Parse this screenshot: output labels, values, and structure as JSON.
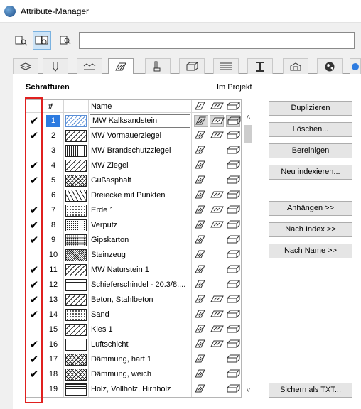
{
  "window": {
    "title": "Attribute-Manager"
  },
  "toolbar": {
    "buttons": [
      {
        "icon": "file-left-view-icon"
      },
      {
        "icon": "split-view-icon"
      },
      {
        "icon": "file-right-view-icon"
      }
    ],
    "search_value": ""
  },
  "tabs": [
    {
      "icon": "layers-icon"
    },
    {
      "icon": "pen-icon"
    },
    {
      "icon": "line-types-icon"
    },
    {
      "icon": "fills-icon",
      "active": true
    },
    {
      "icon": "composites-icon"
    },
    {
      "icon": "profiles-icon"
    },
    {
      "icon": "surfaces-icon"
    },
    {
      "icon": "building-materials-icon"
    },
    {
      "icon": "zone-category-icon"
    },
    {
      "icon": "globe-icon"
    },
    {
      "icon": "more-icon"
    }
  ],
  "section": {
    "title": "Schraffuren",
    "in_project_label": "Im Projekt"
  },
  "grid": {
    "header_num": "#",
    "header_name": "Name",
    "rows": [
      {
        "checked": true,
        "num": "1",
        "name": "MW Kalksandstein",
        "pattern": "diag-blue",
        "selected": true
      },
      {
        "checked": true,
        "num": "2",
        "name": "MW Vormauerziegel",
        "pattern": "diag"
      },
      {
        "checked": false,
        "num": "3",
        "name": "MW Brandschutzziegel",
        "pattern": "hatch-dense"
      },
      {
        "checked": true,
        "num": "4",
        "name": "MW Ziegel",
        "pattern": "diag"
      },
      {
        "checked": true,
        "num": "5",
        "name": "Gußasphalt",
        "pattern": "cross"
      },
      {
        "checked": false,
        "num": "6",
        "name": "Dreiecke mit Punkten",
        "pattern": "triangles"
      },
      {
        "checked": true,
        "num": "7",
        "name": "Erde 1",
        "pattern": "dots"
      },
      {
        "checked": true,
        "num": "8",
        "name": "Verputz",
        "pattern": "fine-dots"
      },
      {
        "checked": true,
        "num": "9",
        "name": "Gipskarton",
        "pattern": "grid-dots"
      },
      {
        "checked": false,
        "num": "10",
        "name": "Steinzeug",
        "pattern": "dense-cross"
      },
      {
        "checked": true,
        "num": "11",
        "name": "MW Naturstein 1",
        "pattern": "diag"
      },
      {
        "checked": true,
        "num": "12",
        "name": "Schieferschindel - 20.3/8....",
        "pattern": "bricks"
      },
      {
        "checked": true,
        "num": "13",
        "name": "Beton, Stahlbeton",
        "pattern": "diag"
      },
      {
        "checked": true,
        "num": "14",
        "name": "Sand",
        "pattern": "dots"
      },
      {
        "checked": false,
        "num": "15",
        "name": "Kies 1",
        "pattern": "diag"
      },
      {
        "checked": true,
        "num": "16",
        "name": "Luftschicht",
        "pattern": "empty"
      },
      {
        "checked": true,
        "num": "17",
        "name": "Dämmung, hart 1",
        "pattern": "cross"
      },
      {
        "checked": true,
        "num": "18",
        "name": "Dämmung, weich",
        "pattern": "cross"
      },
      {
        "checked": false,
        "num": "19",
        "name": "Holz, Vollholz, Hirnholz",
        "pattern": "wood"
      }
    ]
  },
  "buttons": {
    "duplicate": "Duplizieren",
    "delete": "Löschen...",
    "purge": "Bereinigen",
    "reindex": "Neu indexieren...",
    "append": "Anhängen >>",
    "by_index": "Nach Index >>",
    "by_name": "Nach Name >>",
    "save_txt": "Sichern als TXT..."
  },
  "colors": {
    "selection": "#2d7be0",
    "highlight_red": "#e0201f"
  }
}
